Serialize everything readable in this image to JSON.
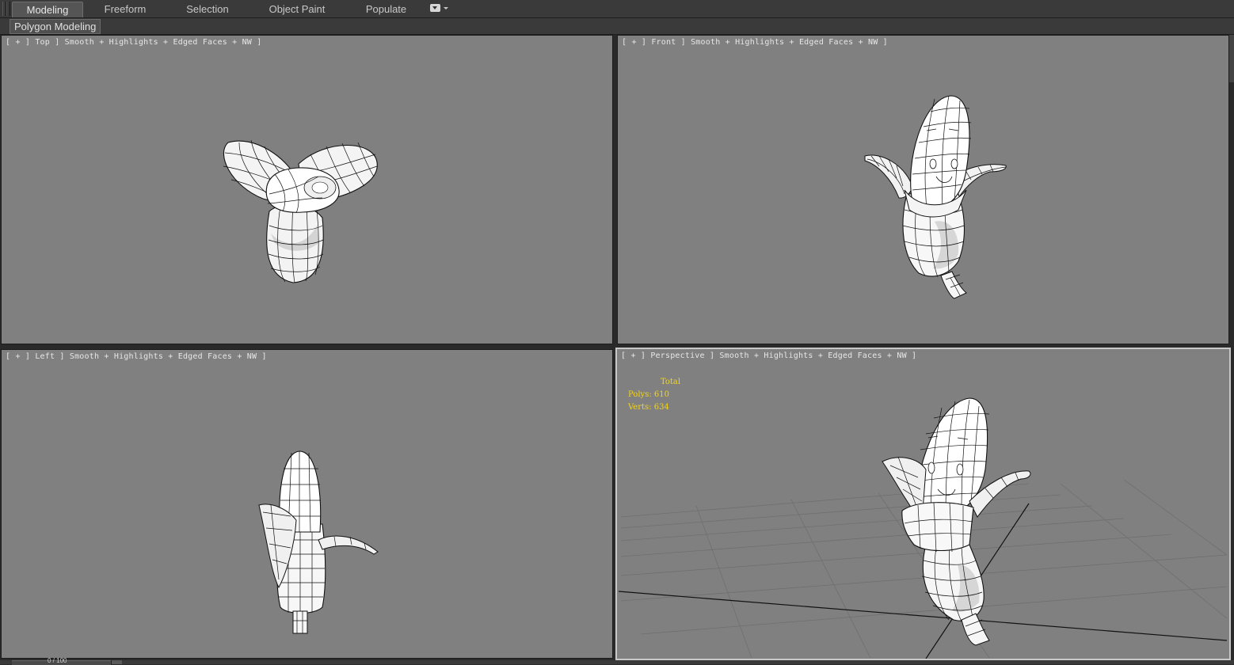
{
  "ribbon": {
    "tabs": [
      {
        "label": "Modeling",
        "active": true
      },
      {
        "label": "Freeform",
        "active": false
      },
      {
        "label": "Selection",
        "active": false
      },
      {
        "label": "Object Paint",
        "active": false
      },
      {
        "label": "Populate",
        "active": false
      }
    ],
    "options_icon": "dropdown-options-icon"
  },
  "subpanel": {
    "label": "Polygon Modeling"
  },
  "viewports": {
    "top": {
      "label": "[ + ] Top ] Smooth + Highlights + Edged Faces + NW ]"
    },
    "front": {
      "label": "[ + ] Front ] Smooth + Highlights + Edged Faces + NW ]"
    },
    "left": {
      "label": "[ + ] Left ] Smooth + Highlights + Edged Faces + NW ]"
    },
    "perspective": {
      "label": "[ + ] Perspective ] Smooth + Highlights + Edged Faces + NW ]",
      "stats": {
        "title": "Total",
        "polys_label": "Polys:",
        "polys": "610",
        "verts_label": "Verts:",
        "verts": "634"
      }
    }
  },
  "timeline": {
    "frame": "0 / 100"
  },
  "colors": {
    "viewport_bg": "#808080",
    "stats_text": "#f2d41e",
    "active_border": "#c8c8c8"
  }
}
